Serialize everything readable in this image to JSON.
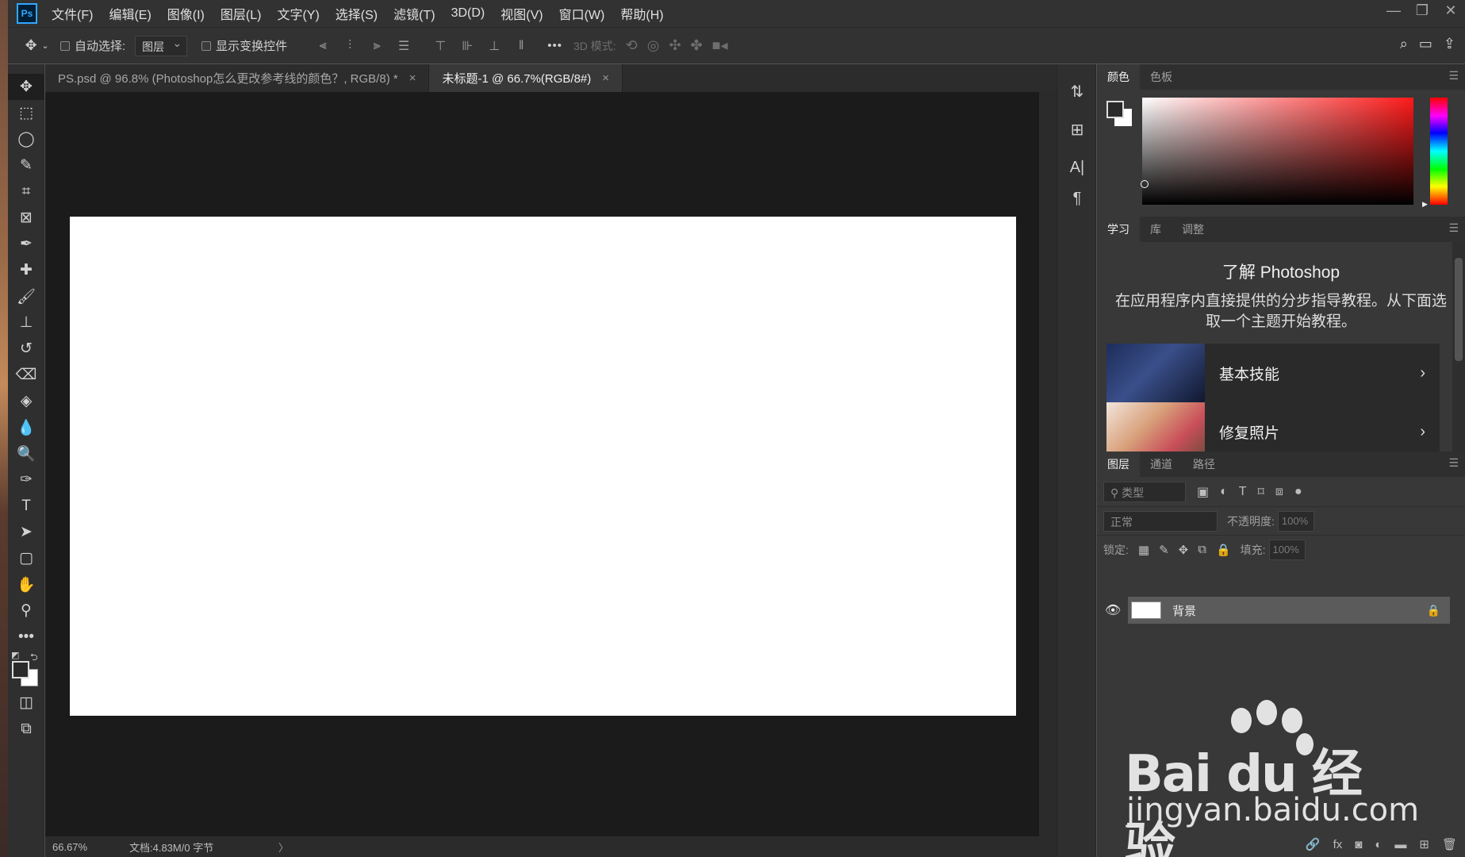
{
  "app": {
    "logo": "Ps"
  },
  "menu": [
    "文件(F)",
    "编辑(E)",
    "图像(I)",
    "图层(L)",
    "文字(Y)",
    "选择(S)",
    "滤镜(T)",
    "3D(D)",
    "视图(V)",
    "窗口(W)",
    "帮助(H)"
  ],
  "window_controls": {
    "minimize": "—",
    "restore": "❐",
    "close": "✕"
  },
  "options": {
    "auto_select_label": "自动选择:",
    "auto_select_value": "图层",
    "show_transform_label": "显示变换控件",
    "more": "•••",
    "mode_3d_label": "3D 模式:"
  },
  "doc_tabs": [
    {
      "title": "PS.psd @ 96.8% (Photoshop怎么更改参考线的颜色？, RGB/8) *",
      "active": false
    },
    {
      "title": "未标题-1 @ 66.7%(RGB/8#)",
      "active": true
    }
  ],
  "status": {
    "zoom": "66.67%",
    "doc_info": "文档:4.83M/0 字节",
    "arrow": "〉"
  },
  "color_panel": {
    "tabs": [
      "颜色",
      "色板"
    ],
    "active": "颜色"
  },
  "learn_panel": {
    "tabs": [
      "学习",
      "库",
      "调整"
    ],
    "active": "学习",
    "title": "了解 Photoshop",
    "description": "在应用程序内直接提供的分步指导教程。从下面选取一个主题开始教程。",
    "cards": [
      "基本技能",
      "修复照片"
    ]
  },
  "layers_panel": {
    "tabs": [
      "图层",
      "通道",
      "路径"
    ],
    "active": "图层",
    "filter_placeholder": "类型",
    "blend_mode": "正常",
    "opacity_label": "不透明度:",
    "opacity_value": "100%",
    "lock_label": "锁定:",
    "fill_label": "填充:",
    "fill_value": "100%",
    "layers": [
      {
        "name": "背景",
        "visible": true,
        "locked": true
      }
    ]
  },
  "watermark": {
    "brand": "Bai du 经验",
    "url": "jingyan.baidu.com"
  }
}
